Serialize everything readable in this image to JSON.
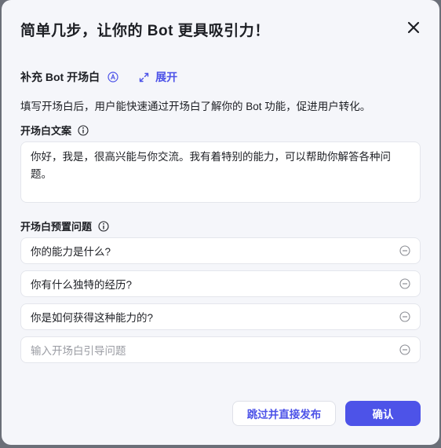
{
  "dialog": {
    "title": "简单几步，让你的 Bot 更具吸引力！",
    "section_title": "补充 Bot 开场白",
    "expand_label": "展开",
    "description": "填写开场白后，用户能快速通过开场白了解你的 Bot 功能，促进用户转化。"
  },
  "opening": {
    "label": "开场白文案",
    "text": "你好，我是，很高兴能与你交流。我有着特别的能力，可以帮助你解答各种问题。"
  },
  "preset": {
    "label": "开场白预置问题",
    "questions": [
      "你的能力是什么?",
      "你有什么独特的经历?",
      "你是如何获得这种能力的?"
    ],
    "input_placeholder": "输入开场白引导问题"
  },
  "footer": {
    "skip_label": "跳过并直接发布",
    "confirm_label": "确认"
  },
  "colors": {
    "accent": "#4d53e8",
    "background": "#f5f6fa"
  }
}
